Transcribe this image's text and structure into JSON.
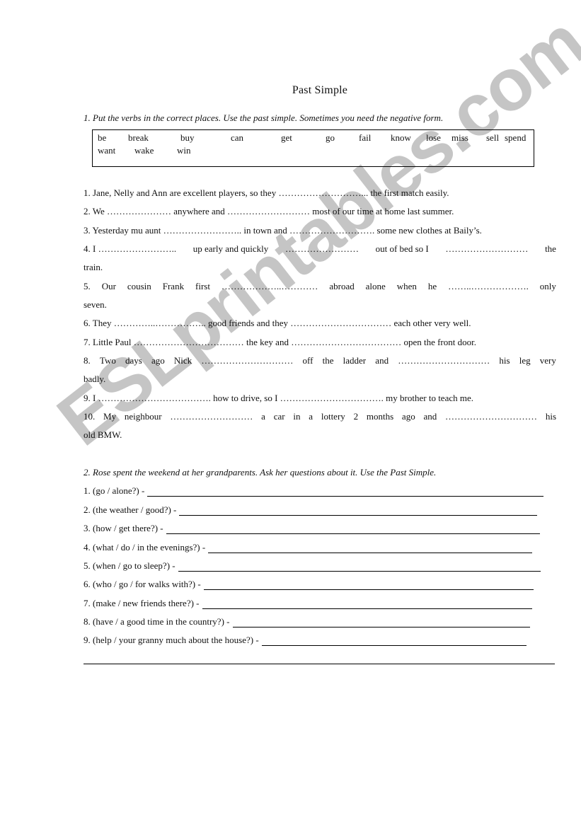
{
  "title": "Past Simple",
  "exercise1": {
    "instruction": "1. Put the verbs in the correct places. Use the past simple. Sometimes you need the negative form.",
    "words": [
      "be",
      "break",
      "buy",
      "can",
      "get",
      "go",
      "fail",
      "know",
      "lose",
      "miss",
      "sell",
      "spend",
      "want",
      "wake",
      "win"
    ],
    "sentences": [
      {
        "text": "1. Jane, Nelly and Ann are excellent players, so they ………………………... the first match easily."
      },
      {
        "text": "2. We ………………… anywhere and ……………………… most of our time at home last summer."
      },
      {
        "text": "3. Yesterday mu aunt …………………….. in town and ………………………. some new clothes at Baily’s."
      },
      {
        "parts": [
          "4. I ……………………..",
          "up early and quickly",
          "……………………",
          "out of bed so I",
          "………………………",
          "the"
        ],
        "cont": "train."
      },
      {
        "parts": [
          "5.",
          "Our",
          "cousin",
          "Frank",
          "first",
          "………………..…………",
          "abroad",
          "alone",
          "when",
          "he",
          "……..……………….",
          "only"
        ],
        "cont": "seven."
      },
      {
        "text": "6. They …………..…………….. good friends and they …………………………… each other very well."
      },
      {
        "text": "7. Little Paul ……………………………… the key and ……………………………… open the front door."
      },
      {
        "parts": [
          "8.",
          "Two",
          "days",
          "ago",
          "Nick",
          "…………………………",
          "off",
          "the",
          "ladder",
          "and",
          "…………………………",
          "his",
          "leg",
          "very"
        ],
        "cont": "badly."
      },
      {
        "text": "9. I ………………………………. how to drive, so I ……………………………. my brother to teach me."
      },
      {
        "parts": [
          "10.",
          "My",
          "neighbour",
          "………………………",
          "a",
          "car",
          "in",
          "a",
          "lottery",
          "2",
          "months",
          "ago",
          "and",
          "…………………………",
          "his"
        ],
        "cont": "old BMW."
      }
    ]
  },
  "exercise2": {
    "instruction": "2. Rose spent the weekend at her grandparents. Ask her questions about it. Use the Past Simple.",
    "questions": [
      "1. (go / alone?) -",
      "2. (the weather / good?) -",
      "3. (how / get there?) -",
      "4. (what / do / in the evenings?) -",
      "5. (when / go to sleep?) -",
      "6. (who / go / for walks with?) -",
      "7. (make / new friends there?) -",
      "8. (have / a good time in the country?) -",
      "9. (help / your granny much about the house?) -"
    ]
  },
  "watermark": "ESLprintables.com"
}
